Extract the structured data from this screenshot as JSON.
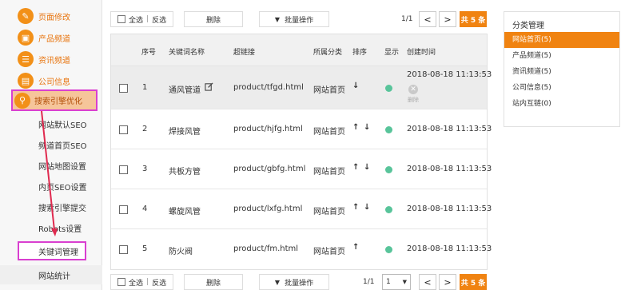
{
  "sidebar": {
    "menu": [
      {
        "label": "页面修改",
        "icon": "pencil-icon"
      },
      {
        "label": "产品频道",
        "icon": "box-icon"
      },
      {
        "label": "资讯频道",
        "icon": "news-icon"
      },
      {
        "label": "公司信息",
        "icon": "building-icon"
      },
      {
        "label": "搜索引擎优化",
        "icon": "search-icon"
      }
    ],
    "submenu": [
      {
        "label": "网站默认SEO"
      },
      {
        "label": "频道首页SEO"
      },
      {
        "label": "网站地图设置"
      },
      {
        "label": "内页SEO设置"
      },
      {
        "label": "搜索引擎提交"
      },
      {
        "label": "Robots设置"
      },
      {
        "label": "关键词管理"
      },
      {
        "label": "网站统计"
      }
    ],
    "accent_color": "#f29018",
    "highlight_color": "#d93fd0"
  },
  "toolbar": {
    "check_all": "全选",
    "separator": "|",
    "invert": "反选",
    "delete": "删除",
    "batch": "批量操作",
    "page_info": "1/1",
    "prev": "<",
    "next": ">",
    "total": "共 5 条",
    "page_select_value": "1"
  },
  "table": {
    "headers": {
      "index": "序号",
      "name": "关键词名称",
      "link": "超链接",
      "category": "所属分类",
      "sort": "排序",
      "display": "显示",
      "created": "创建时间"
    },
    "rows": [
      {
        "index": "1",
        "name": "通风管道",
        "link": "product/tfgd.html",
        "category": "网站首页",
        "created": "2018-08-18 11:13:53",
        "delete_label": "删除",
        "sort": [
          "down"
        ]
      },
      {
        "index": "2",
        "name": "焊接风管",
        "link": "product/hjfg.html",
        "category": "网站首页",
        "created": "2018-08-18 11:13:53",
        "sort": [
          "up",
          "down"
        ]
      },
      {
        "index": "3",
        "name": "共板方管",
        "link": "product/gbfg.html",
        "category": "网站首页",
        "created": "2018-08-18 11:13:53",
        "sort": [
          "up",
          "down"
        ]
      },
      {
        "index": "4",
        "name": "螺旋风管",
        "link": "product/lxfg.html",
        "category": "网站首页",
        "created": "2018-08-18 11:13:53",
        "sort": [
          "up",
          "down"
        ]
      },
      {
        "index": "5",
        "name": "防火阀",
        "link": "product/fm.html",
        "category": "网站首页",
        "created": "2018-08-18 11:13:53",
        "sort": [
          "up"
        ]
      }
    ],
    "status_color": "#58c49a"
  },
  "category_panel": {
    "title": "分类管理",
    "items": [
      {
        "label": "网站首页(5)"
      },
      {
        "label": "产品频道(5)"
      },
      {
        "label": "资讯频道(5)"
      },
      {
        "label": "公司信息(5)"
      },
      {
        "label": "站内互链(0)"
      }
    ],
    "selected_color": "#f08311"
  }
}
